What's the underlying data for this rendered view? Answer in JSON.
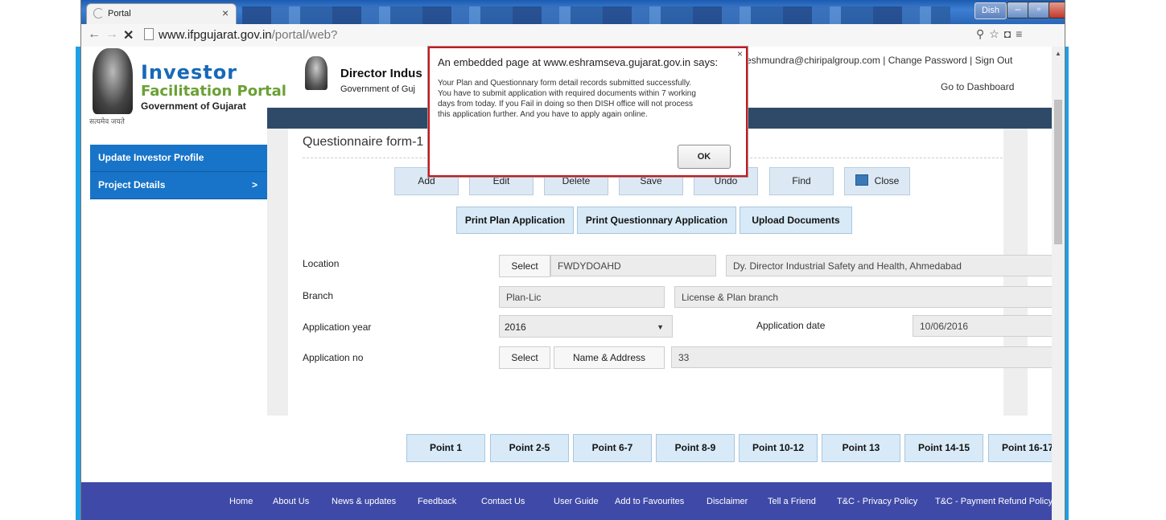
{
  "browser": {
    "tab_title": "Portal",
    "tab_close": "×",
    "dish_label": "Dish",
    "url_host": "www.ifpgujarat.gov.in",
    "url_path": "/portal/web?"
  },
  "header": {
    "logo_line1": "Investor",
    "logo_line2": "Facilitation Portal",
    "logo_line3": "Government of Gujarat",
    "logo_line4": "सत्यमेव जयते",
    "director_title": "Director Indus",
    "director_sub": "Government of Guj",
    "user_email": "eshmundra@chiripalgroup.com",
    "link_sep": "|",
    "change_password": "Change Password",
    "sign_out": "Sign Out",
    "go_dashboard": "Go to Dashboard"
  },
  "sidebar": {
    "items": [
      {
        "label": "Update Investor Profile"
      },
      {
        "label": "Project Details",
        "chevron": ">"
      }
    ]
  },
  "form": {
    "title": "Questionnaire form-1",
    "toolbar": {
      "btn1": "Add",
      "btn2": "Edit",
      "btn3": "Delete",
      "btn4": "Save",
      "btn5": "Undo",
      "find": "Find",
      "close": "Close"
    },
    "print_buttons": [
      "Print Plan Application",
      "Print Questionnary Application",
      "Upload Documents"
    ],
    "location": {
      "label": "Location",
      "select": "Select",
      "code": "FWDYDOAHD",
      "name": "Dy. Director Industrial Safety and Health, Ahmedabad"
    },
    "branch": {
      "label": "Branch",
      "code": "Plan-Lic",
      "name": "License & Plan branch"
    },
    "app_year": {
      "label": "Application year",
      "value": "2016",
      "caret": "▼"
    },
    "app_date": {
      "label": "Application date",
      "value": "10/06/2016"
    },
    "app_no": {
      "label": "Application no",
      "select": "Select",
      "name_addr": "Name & Address",
      "value": "33"
    },
    "points": [
      "Point 1",
      "Point 2-5",
      "Point 6-7",
      "Point 8-9",
      "Point 10-12",
      "Point 13",
      "Point 14-15",
      "Point 16-17"
    ]
  },
  "footer": {
    "links": [
      "Home",
      "About Us",
      "News & updates",
      "Feedback",
      "Contact Us",
      "User Guide",
      "Add to Favourites",
      "Disclaimer",
      "Tell a Friend",
      "T&C - Privacy Policy",
      "T&C - Payment Refund Policy"
    ]
  },
  "dialog": {
    "header": "An embedded page at www.eshramseva.gujarat.gov.in says:",
    "line1": "Your Plan and Questionnary form detail records submitted successfully.",
    "line2": "You have to submit application with required documents within 7 working",
    "line3": "days from today. If you Fail in doing so then DISH office will not process",
    "line4": "this application further. And you have to apply again online.",
    "ok": "OK",
    "close": "×"
  }
}
